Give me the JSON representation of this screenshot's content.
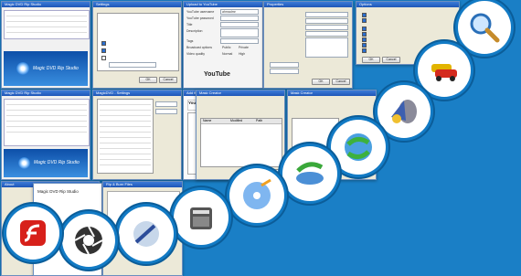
{
  "win_a": {
    "title": "Magic DVD Rip Studio",
    "logo": "Magic DVD Rip Studio"
  },
  "win_b": {
    "title": "Magic DVD Rip Studio",
    "logo": "Magic DVD Rip Studio"
  },
  "win_c": {
    "title": "Settings",
    "ok": "OK",
    "cancel": "Cancel"
  },
  "win_d": {
    "title": "Upload to YouTube",
    "labels": [
      "YouTube username",
      "YouTube password",
      "Title",
      "Description",
      "Tags",
      "Video category",
      "Broadcast options",
      "Video quality"
    ],
    "values": [
      "ahmadmr",
      "",
      "",
      "",
      "",
      "",
      "Public",
      "High"
    ],
    "option_private": "Private",
    "option_normal": "Normal",
    "youtube_logo": "YouTube",
    "submit": "Upload"
  },
  "win_e": {
    "title": "Properties",
    "tabs": [
      "General",
      "Output"
    ],
    "ok": "OK",
    "cancel": "Cancel"
  },
  "win_f": {
    "title": "Options",
    "ok": "OK",
    "cancel": "Cancel"
  },
  "win_g": {
    "title": "MagicDVD - Settings",
    "ok": "OK",
    "cancel": "Cancel"
  },
  "win_h": {
    "title": "Add files",
    "youtube_logo": "YouTube"
  },
  "win_i": {
    "title": "Mask Creator",
    "headers": [
      "Name",
      "Modified",
      "Path"
    ],
    "next": "Next",
    "cancel": "Cancel"
  },
  "win_j": {
    "title": "Mask Creator",
    "next": "Next",
    "cancel": "Cancel"
  },
  "win_k": {
    "title": "About"
  },
  "win_l": {
    "title": "Magic DVD Rip Studio",
    "logo": "Magic DVD Rip Studio"
  },
  "win_m": {
    "title": "Rip & Burn Files"
  },
  "icons": [
    "search-icon",
    "car-icon",
    "media-player-icon",
    "sync-globe-icon",
    "sync-disc-icon",
    "dvd-disc-icon",
    "film-clapper-icon",
    "disc-tool-icon",
    "aperture-icon",
    "flash-icon"
  ],
  "colors": {
    "background": "#1a7fc6",
    "titlebar": "#2a62c4",
    "circle_ring": "#0b5d99"
  }
}
